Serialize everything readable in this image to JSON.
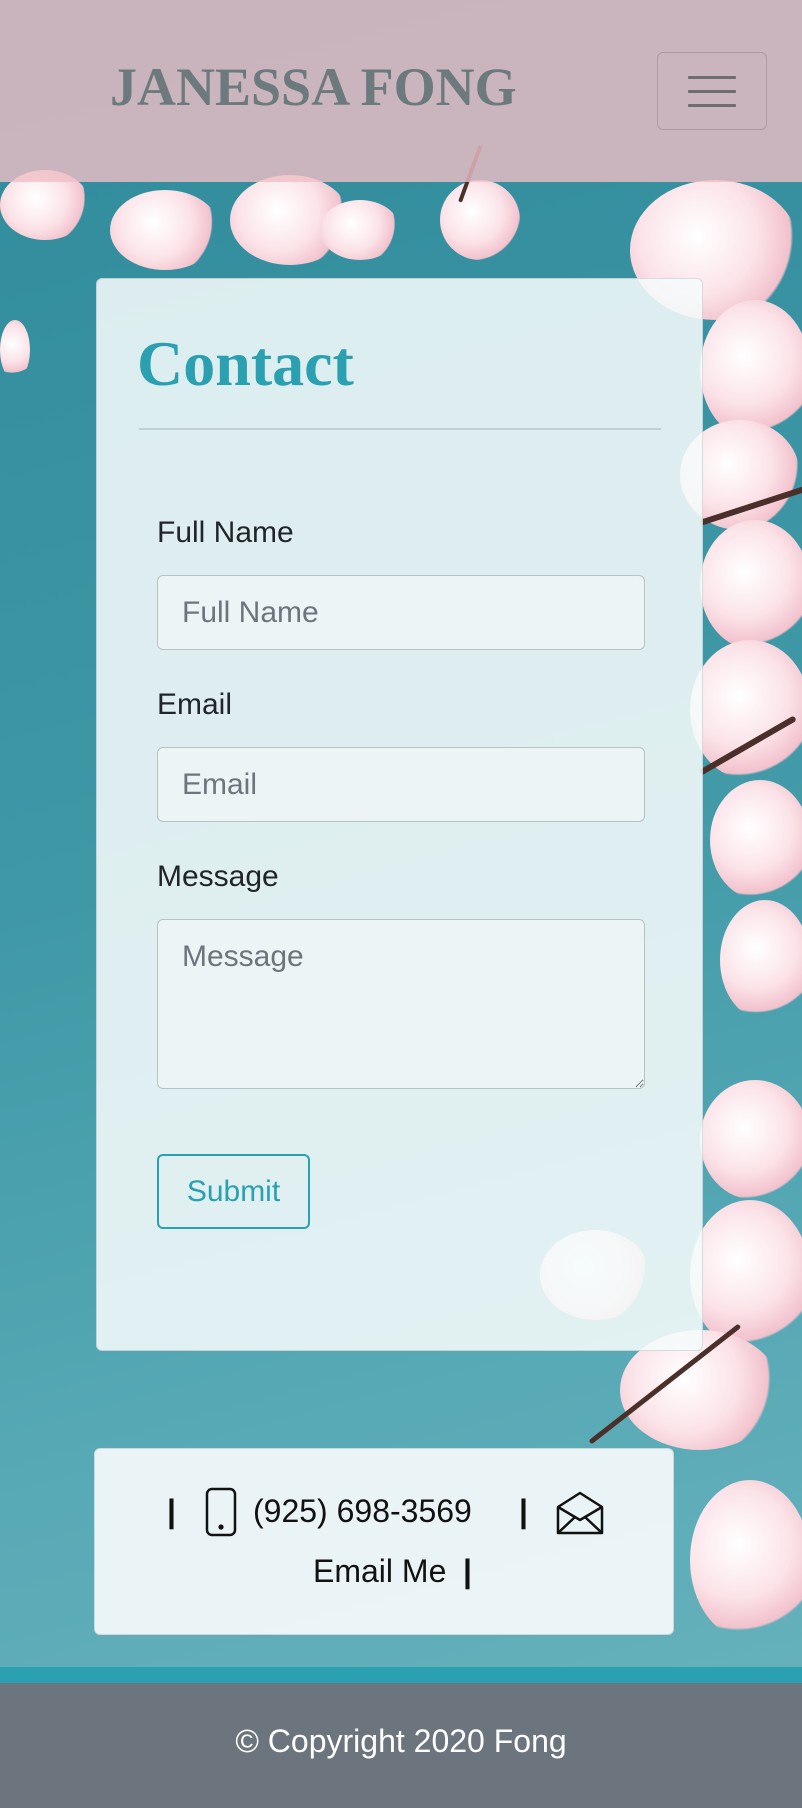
{
  "navbar": {
    "brand": "JANESSA FONG",
    "toggle_icon": "hamburger-menu-icon"
  },
  "contact": {
    "title": "Contact",
    "full_name_label": "Full Name",
    "full_name_placeholder": "Full Name",
    "email_label": "Email",
    "email_placeholder": "Email",
    "message_label": "Message",
    "message_placeholder": "Message",
    "submit_label": "Submit"
  },
  "info": {
    "separator": "|",
    "phone_icon": "phone-icon",
    "phone": "(925) 698-3569",
    "email_icon": "envelope-icon",
    "email_text": "Email Me"
  },
  "footer": {
    "copyright": "© Copyright 2020 Fong"
  },
  "colors": {
    "accent": "#2aa0b0",
    "navbar_bg": "#f0bec6",
    "footer_bg": "#6c757d",
    "brand_text": "#6c7a7d"
  }
}
